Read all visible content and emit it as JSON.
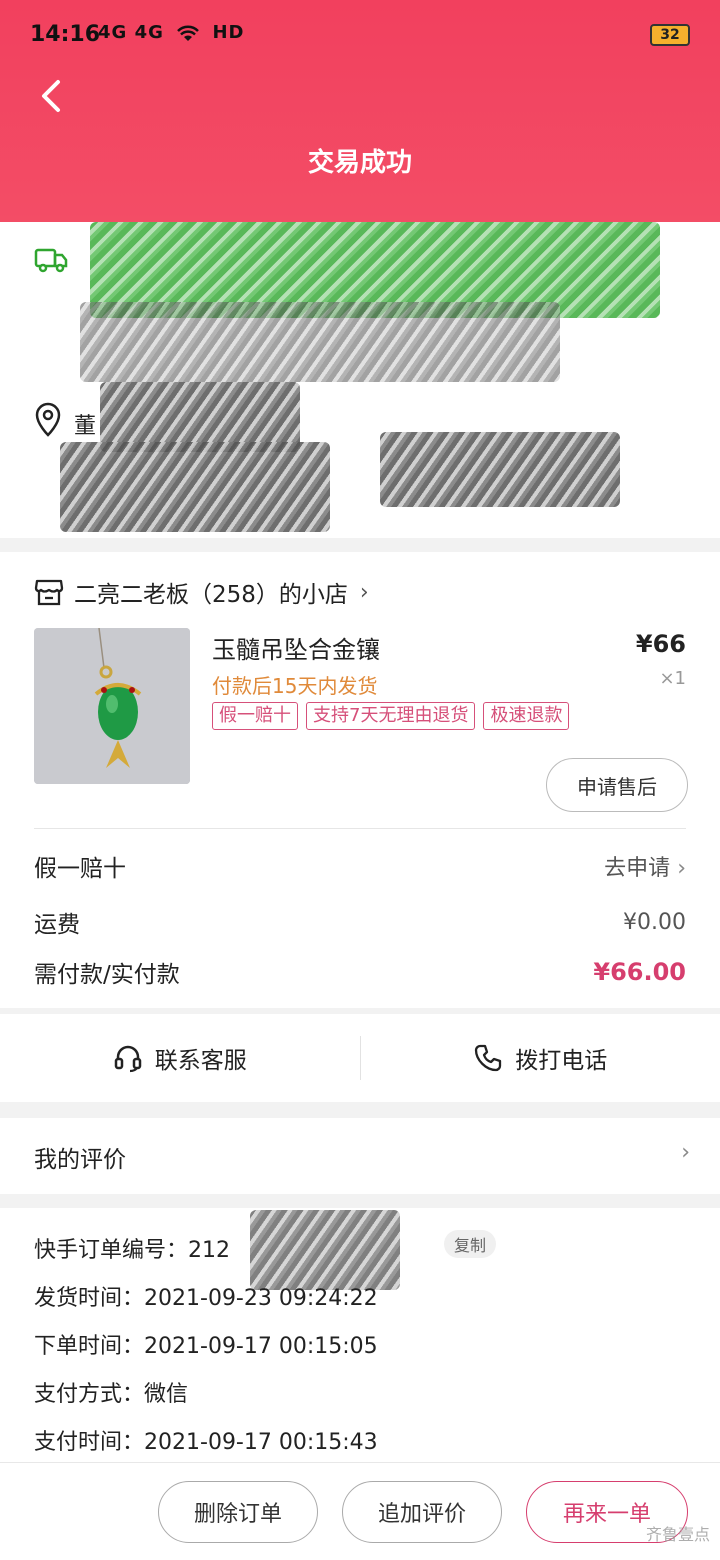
{
  "status_bar": {
    "time": "14:16",
    "signal": "4G 4G",
    "wifi": "HD",
    "battery": "32"
  },
  "header": {
    "title": "交易成功"
  },
  "address": {
    "name_partial": "董"
  },
  "store": {
    "name": "二亮二老板（258）的小店",
    "product": {
      "title": "玉髓吊坠合金镶",
      "price": "¥66",
      "qty": "×1",
      "ship_note": "付款后15天内发货",
      "tags": [
        "假一赔十",
        "支持7天无理由退货",
        "极速退款"
      ],
      "aftersale_label": "申请售后"
    },
    "fees": {
      "guarantee_label": "假一赔十",
      "guarantee_link": "去申请",
      "shipping_label": "运费",
      "shipping_value": "¥0.00",
      "total_label": "需付款/实付款",
      "total_value": "¥66.00"
    }
  },
  "contact": {
    "service_label": "联系客服",
    "phone_label": "拨打电话"
  },
  "review": {
    "label": "我的评价"
  },
  "order": {
    "number_label": "快手订单编号：",
    "number_value": "212",
    "copy_label": "复制",
    "ship_time_label": "发货时间：",
    "ship_time_value": "2021-09-23 09:24:22",
    "order_time_label": "下单时间：",
    "order_time_value": "2021-09-17 00:15:05",
    "pay_method_label": "支付方式：",
    "pay_method_value": "微信",
    "pay_time_label": "支付时间：",
    "pay_time_value": "2021-09-17 00:15:43"
  },
  "bottom": {
    "delete_label": "删除订单",
    "add_review_label": "追加评价",
    "reorder_label": "再来一单"
  },
  "watermark": "齐鲁壹点",
  "colors": {
    "header": "#f2405e",
    "accent_pink": "#d63e6e",
    "ship_note": "#e08a3a",
    "truck_green": "#2fa52f"
  }
}
